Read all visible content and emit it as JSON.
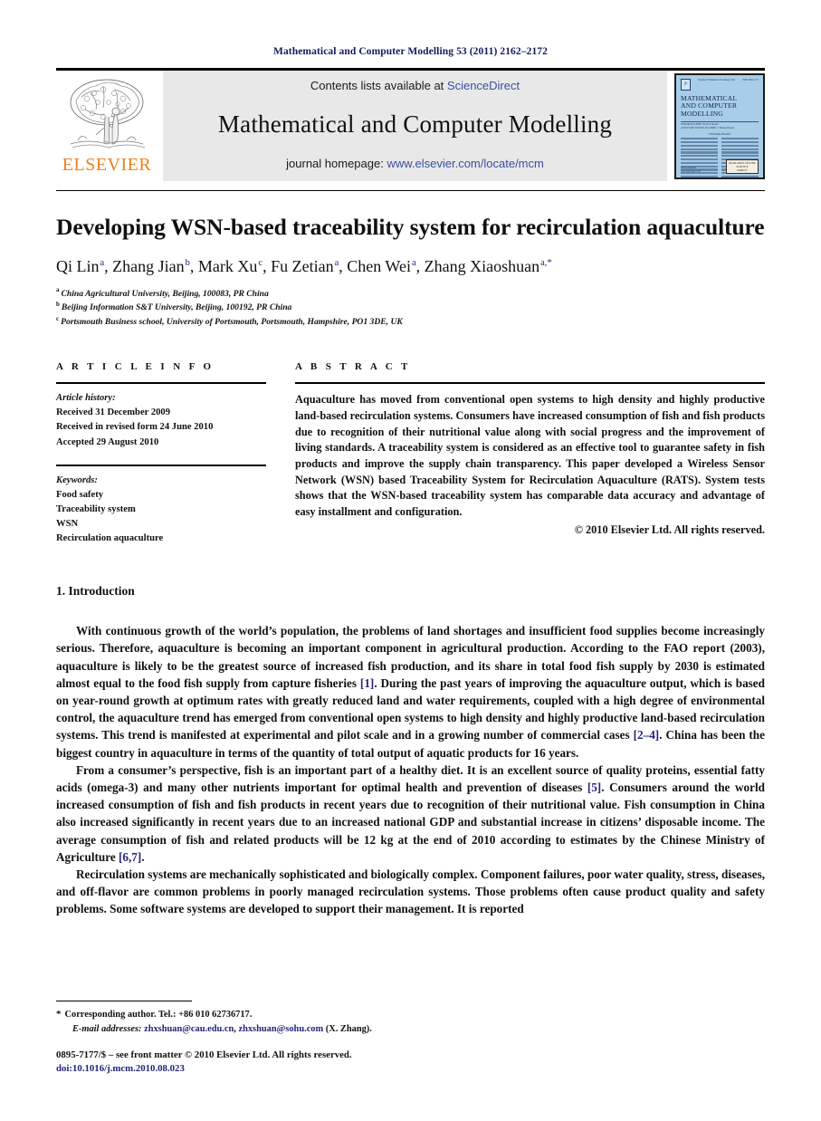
{
  "running_head": "Mathematical and Computer Modelling 53 (2011) 2162–2172",
  "masthead": {
    "publisher_wordmark": "ELSEVIER",
    "contents_prefix": "Contents lists available at ",
    "contents_link": "ScienceDirect",
    "journal_name": "Mathematical and Computer Modelling",
    "homepage_prefix": "journal homepage: ",
    "homepage_link": "www.elsevier.com/locate/mcm",
    "link_color": "#3b4fa0",
    "elsevier_orange": "#f07f1a"
  },
  "cover": {
    "issn_top": "ISSN 0895-7177",
    "volume_line": "Volume 53 Numbers 9-10  January 2011",
    "title_line1": "MATHEMATICAL",
    "title_line2": "AND COMPUTER",
    "title_line3": "MODELLING",
    "editor_line1": "EDITOR-IN-CHIEF: Ervin Y. Rodin",
    "editor_line2": "ASSOCIATE EDITOR-IN-CHIEF: J. Bernard Keats",
    "board_label": "EDITORIAL BOARD",
    "publisher": "PERGAMON",
    "publisher_url": "www.elsevier.com",
    "badge_line1": "AVAILABLE ONLINE",
    "badge_line2": "SCIENCE",
    "badge_line3": "DIRECT",
    "bg_color": "#a8cde8"
  },
  "article": {
    "title": "Developing WSN-based traceability system for recirculation aquaculture",
    "authors": [
      {
        "name": "Qi Lin",
        "sup": "a",
        "sep": ", "
      },
      {
        "name": "Zhang Jian",
        "sup": "b",
        "sep": ", "
      },
      {
        "name": "Mark Xu",
        "sup": "c",
        "sep": ", "
      },
      {
        "name": "Fu Zetian",
        "sup": "a",
        "sep": ", "
      },
      {
        "name": "Chen Wei",
        "sup": "a",
        "sep": ", "
      },
      {
        "name": "Zhang Xiaoshuan",
        "sup": "a,*",
        "sep": ""
      }
    ],
    "affiliations": [
      {
        "mark": "a",
        "text": "China Agricultural University, Beijing, 100083, PR China"
      },
      {
        "mark": "b",
        "text": "Beijing Information S&T University, Beijing, 100192, PR China"
      },
      {
        "mark": "c",
        "text": "Portsmouth Business school, University of Portsmouth, Portsmouth, Hampshire, PO1 3DE, UK"
      }
    ]
  },
  "article_info": {
    "heading": "A R T I C L E    I N F O",
    "history_label": "Article history:",
    "history": [
      "Received 31 December 2009",
      "Received in revised form 24 June 2010",
      "Accepted 29 August 2010"
    ],
    "keywords_label": "Keywords:",
    "keywords": [
      "Food safety",
      "Traceability system",
      "WSN",
      "Recirculation aquaculture"
    ]
  },
  "abstract": {
    "heading": "A B S T R A C T",
    "text": "Aquaculture has moved from conventional open systems to high density and highly productive land-based recirculation systems. Consumers have increased consumption of fish and fish products due to recognition of their nutritional value along with social progress and the improvement of living standards. A traceability system is considered as an effective tool to guarantee safety in fish products and improve the supply chain transparency. This paper developed a Wireless Sensor Network (WSN) based Traceability System for Recirculation Aquaculture (RATS). System tests shows that the WSN-based traceability system has comparable data accuracy and advantage of easy installment and configuration.",
    "copyright": "© 2010 Elsevier Ltd. All rights reserved."
  },
  "body": {
    "section_heading": "1. Introduction",
    "paragraphs": [
      {
        "segments": [
          {
            "t": "With continuous growth of the world’s population, the problems of land shortages and insufficient food supplies become increasingly serious. Therefore, aquaculture is becoming an important component in agricultural production. According to the FAO report (2003), aquaculture is likely to be the greatest source of increased fish production, and its share in total food fish supply by 2030 is estimated almost equal to the food fish supply from capture fisheries ",
            "c": false
          },
          {
            "t": "[1]",
            "c": true
          },
          {
            "t": ". During the past years of improving the aquaculture output, which is based on year-round growth at optimum rates with greatly reduced land and water requirements, coupled with a high degree of environmental control, the aquaculture trend has emerged from conventional open systems to high density and highly productive land-based recirculation systems. This trend is manifested at experimental and pilot scale and in a growing number of commercial cases ",
            "c": false
          },
          {
            "t": "[2–4]",
            "c": true
          },
          {
            "t": ". China has been the biggest country in aquaculture in terms of the quantity of total output of aquatic products for 16 years.",
            "c": false
          }
        ]
      },
      {
        "segments": [
          {
            "t": "From a consumer’s perspective, fish is an important part of a healthy diet. It is an excellent source of quality proteins, essential fatty acids (omega-3) and many other nutrients important for optimal health and prevention of diseases ",
            "c": false
          },
          {
            "t": "[5]",
            "c": true
          },
          {
            "t": ". Consumers around the world increased consumption of fish and fish products in recent years due to recognition of their nutritional value. Fish consumption in China also increased significantly in recent years due to an increased national GDP and substantial increase in citizens’ disposable income. The average consumption of fish and related products will be 12 kg at the end of 2010 according to estimates by the Chinese Ministry of Agriculture ",
            "c": false
          },
          {
            "t": "[6,7]",
            "c": true
          },
          {
            "t": ".",
            "c": false
          }
        ]
      },
      {
        "segments": [
          {
            "t": "Recirculation systems are mechanically sophisticated and biologically complex. Component failures, poor water quality, stress, diseases, and off-flavor are common problems in poorly managed recirculation systems. Those problems often cause product quality and safety problems. Some software systems are developed to support their management. It is reported",
            "c": false
          }
        ]
      }
    ]
  },
  "footnotes": {
    "corresponding_star": "*",
    "corresponding_text": "Corresponding author. Tel.: +86 010 62736717.",
    "email_label": "E-mail addresses:",
    "email_1": "zhxshuan@cau.edu.cn",
    "email_sep": ", ",
    "email_2": "zhxshuan@sohu.com",
    "email_suffix": " (X. Zhang).",
    "issn_line": "0895-7177/$ – see front matter © 2010 Elsevier Ltd. All rights reserved.",
    "doi_line": "doi:10.1016/j.mcm.2010.08.023"
  }
}
